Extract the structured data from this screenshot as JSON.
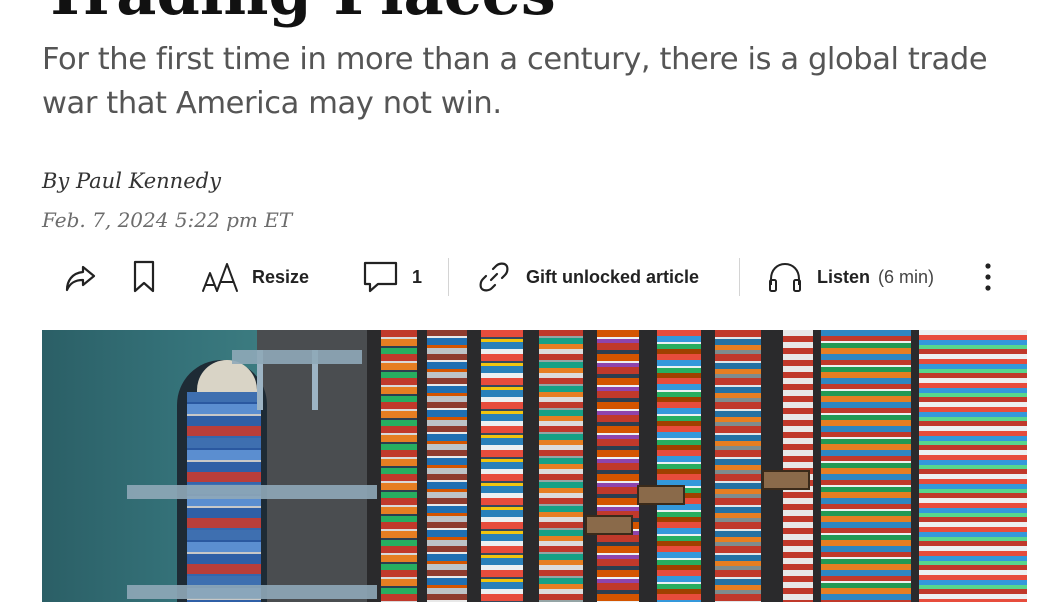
{
  "article": {
    "headline": "Trading Places",
    "dek": "For the first time in more than a century, there is a global trade war that America may not win.",
    "byline": "By Paul Kennedy",
    "date": "Feb. 7, 2024 5:22 pm ET"
  },
  "toolbar": {
    "share_icon": "share-arrow-icon",
    "bookmark_icon": "bookmark-icon",
    "resize_icon": "text-size-icon",
    "resize_label": "Resize",
    "comments_icon": "comment-bubble-icon",
    "comments_count": "1",
    "gift_icon": "link-icon",
    "gift_label": "Gift unlocked article",
    "listen_icon": "headphones-icon",
    "listen_label": "Listen",
    "listen_duration": "(6 min)",
    "more_icon": "vertical-ellipsis-icon"
  },
  "image": {
    "subject": "aerial-container-port"
  },
  "colors": {
    "text": "#222222",
    "muted": "#555555",
    "divider": "#d4d4d4"
  }
}
